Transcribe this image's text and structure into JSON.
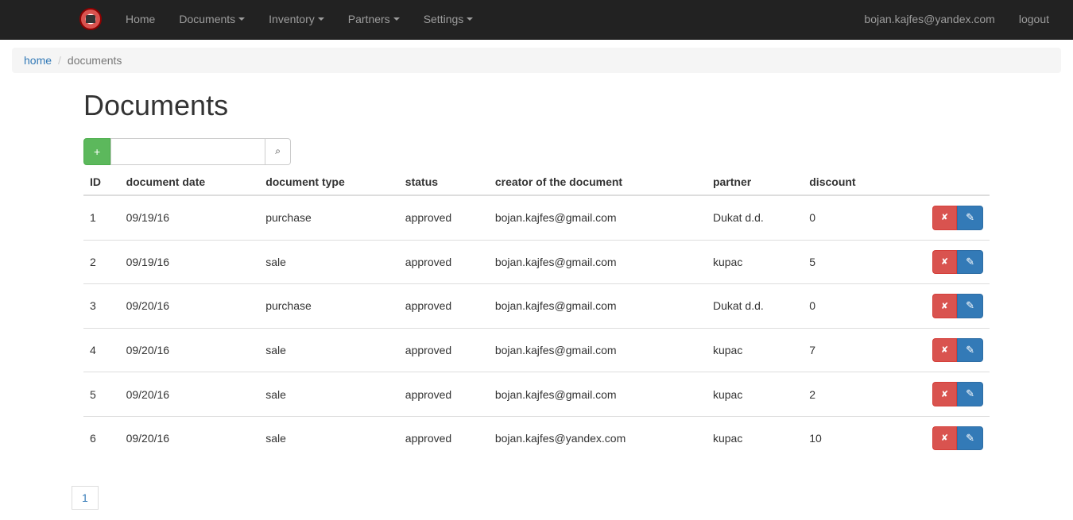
{
  "nav": {
    "home": "Home",
    "documents": "Documents",
    "inventory": "Inventory",
    "partners": "Partners",
    "settings": "Settings",
    "user": "bojan.kajfes@yandex.com",
    "logout": "logout"
  },
  "breadcrumb": {
    "home": "home",
    "current": "documents"
  },
  "page": {
    "title": "Documents",
    "add_button": "+",
    "search_value": ""
  },
  "table": {
    "headers": {
      "id": "ID",
      "date": "document date",
      "type": "document type",
      "status": "status",
      "creator": "creator of the document",
      "partner": "partner",
      "discount": "discount"
    },
    "rows": [
      {
        "id": "1",
        "date": "09/19/16",
        "type": "purchase",
        "status": "approved",
        "creator": "bojan.kajfes@gmail.com",
        "partner": "Dukat d.d.",
        "discount": "0"
      },
      {
        "id": "2",
        "date": "09/19/16",
        "type": "sale",
        "status": "approved",
        "creator": "bojan.kajfes@gmail.com",
        "partner": "kupac",
        "discount": "5"
      },
      {
        "id": "3",
        "date": "09/20/16",
        "type": "purchase",
        "status": "approved",
        "creator": "bojan.kajfes@gmail.com",
        "partner": "Dukat d.d.",
        "discount": "0"
      },
      {
        "id": "4",
        "date": "09/20/16",
        "type": "sale",
        "status": "approved",
        "creator": "bojan.kajfes@gmail.com",
        "partner": "kupac",
        "discount": "7"
      },
      {
        "id": "5",
        "date": "09/20/16",
        "type": "sale",
        "status": "approved",
        "creator": "bojan.kajfes@gmail.com",
        "partner": "kupac",
        "discount": "2"
      },
      {
        "id": "6",
        "date": "09/20/16",
        "type": "sale",
        "status": "approved",
        "creator": "bojan.kajfes@yandex.com",
        "partner": "kupac",
        "discount": "10"
      }
    ]
  },
  "pagination": {
    "page1": "1"
  }
}
